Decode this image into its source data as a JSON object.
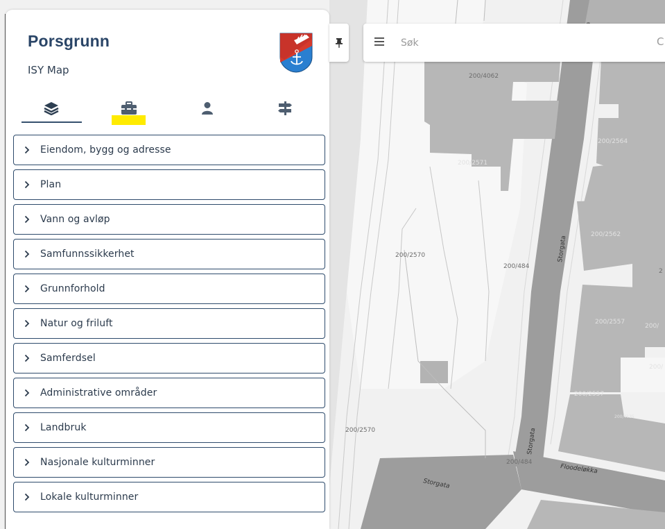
{
  "panel": {
    "title": "Porsgrunn",
    "subtitle": "ISY Map",
    "tabs": [
      {
        "icon": "layers-icon",
        "active": true
      },
      {
        "icon": "toolbox-icon",
        "active": false,
        "highlight": "#ffeb00"
      },
      {
        "icon": "user-icon",
        "active": false
      },
      {
        "icon": "signpost-icon",
        "active": false
      }
    ],
    "categories": [
      "Eiendom, bygg og adresse",
      "Plan",
      "Vann og avløp",
      "Samfunnssikkerhet",
      "Grunnforhold",
      "Natur og friluft",
      "Samferdsel",
      "Administrative områder",
      "Landbruk",
      "Nasjonale kulturminner",
      "Lokale kulturminner"
    ]
  },
  "search": {
    "placeholder": "Søk"
  },
  "map": {
    "parcel_labels": [
      "200/4062",
      "200/2564",
      "200/2571",
      "200/2562",
      "200/2570",
      "200/484",
      "200/2557",
      "200/2557",
      "200/2570",
      "200/484",
      "200/4135",
      "2",
      "200/",
      "200/"
    ],
    "street_labels": [
      "Storgata",
      "Storgata",
      "Storgata",
      "Floodeløkka"
    ]
  },
  "colors": {
    "brand_text": "#2a4567",
    "border": "#2d4a6b",
    "highlight": "#ffeb00",
    "building": "#b7b7b7",
    "road": "#9d9d9d"
  }
}
